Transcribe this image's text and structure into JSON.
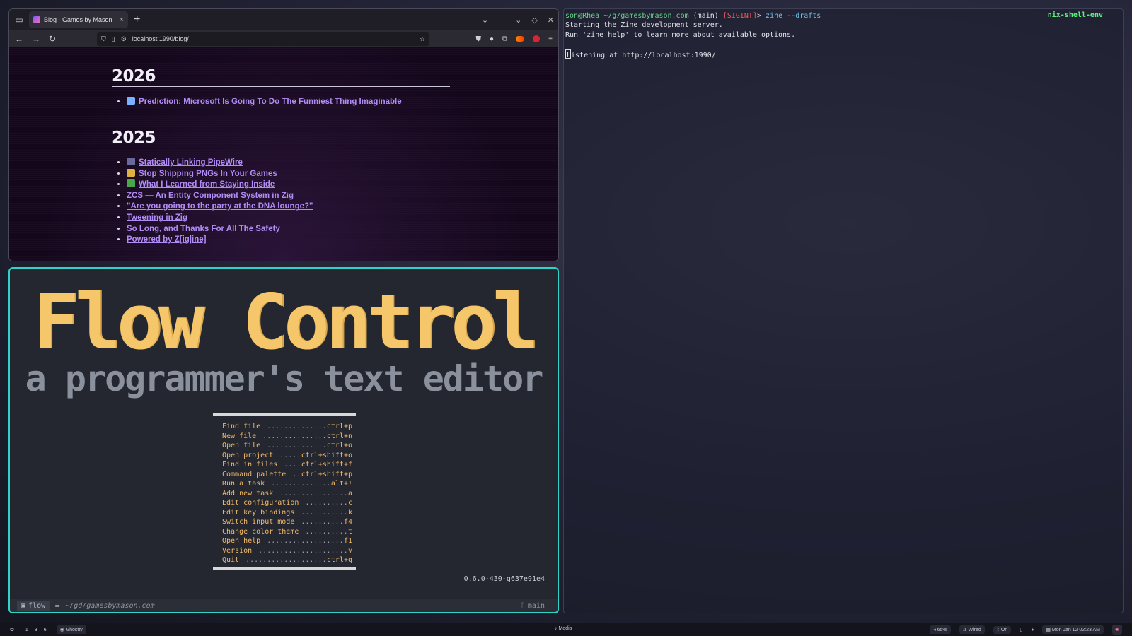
{
  "browser": {
    "tab_title": "Blog - Games by Mason",
    "url": "localhost:1990/blog/",
    "sections": [
      {
        "year": "2026",
        "posts": [
          {
            "title": "Prediction: Microsoft Is Going To Do The Funniest Thing Imaginable",
            "icon": "windows-emoji",
            "color": "#7ab0ff"
          }
        ]
      },
      {
        "year": "2025",
        "posts": [
          {
            "title": "Statically Linking PipeWire",
            "icon": "speaker-emoji",
            "color": "#6a6a9a"
          },
          {
            "title": "Stop Shipping PNGs In Your Games",
            "icon": "picture-emoji",
            "color": "#e0b040"
          },
          {
            "title": "What I Learned from Staying Inside",
            "icon": "palm-tree-emoji",
            "color": "#4aa84a"
          },
          {
            "title": "ZCS — An Entity Component System in Zig",
            "icon": "",
            "color": ""
          },
          {
            "title": "\"Are you going to the party at the DNA lounge?\"",
            "icon": "",
            "color": ""
          },
          {
            "title": "Tweening in Zig",
            "icon": "",
            "color": ""
          },
          {
            "title": "So Long, and Thanks For All The Safety",
            "icon": "",
            "color": ""
          },
          {
            "title": "Powered by Z[ig|ine]",
            "icon": "",
            "color": ""
          }
        ]
      }
    ]
  },
  "editor": {
    "title": "Flow Control",
    "subtitle": "a programmer's text editor",
    "menu": [
      {
        "label": "Find file",
        "key": "ctrl+p"
      },
      {
        "label": "New file",
        "key": "ctrl+n"
      },
      {
        "label": "Open file",
        "key": "ctrl+o"
      },
      {
        "label": "Open project",
        "key": "ctrl+shift+o"
      },
      {
        "label": "Find in files",
        "key": "ctrl+shift+f"
      },
      {
        "label": "Command palette",
        "key": "ctrl+shift+p"
      },
      {
        "label": "Run a task",
        "key": "alt+!"
      },
      {
        "label": "Add new task",
        "key": "a"
      },
      {
        "label": "Edit configuration",
        "key": "c"
      },
      {
        "label": "Edit key bindings",
        "key": "k"
      },
      {
        "label": "Switch input mode",
        "key": "f4"
      },
      {
        "label": "Change color theme",
        "key": "t"
      },
      {
        "label": "Open help",
        "key": "f1"
      },
      {
        "label": "Version",
        "key": "v"
      },
      {
        "label": "Quit",
        "key": "ctrl+q"
      }
    ],
    "version": "0.6.0-430-g637e91e4",
    "status": {
      "mode": "flow",
      "path": "~/gd/gamesbymason.com",
      "branch": "main"
    }
  },
  "terminal": {
    "prompt_user": "son@Rhea",
    "prompt_path": "~/g/gamesbymason.com",
    "prompt_branch": "(main)",
    "prompt_signal": "[SIGINT]",
    "prompt_symbol": ">",
    "command": "zine --drafts",
    "env_label": "nix-shell-env",
    "output": [
      "Starting the Zine development server.",
      "Run 'zine help' to learn more about available options.",
      "",
      "Listening at http://localhost:1990/"
    ]
  },
  "panel": {
    "workspaces": [
      "1",
      "3",
      "6"
    ],
    "active_app": "Ghostty",
    "media": "Media",
    "volume": "65%",
    "network": "Wired",
    "bluetooth": "On",
    "datetime": "Mon Jan 12 02:23 AM"
  }
}
